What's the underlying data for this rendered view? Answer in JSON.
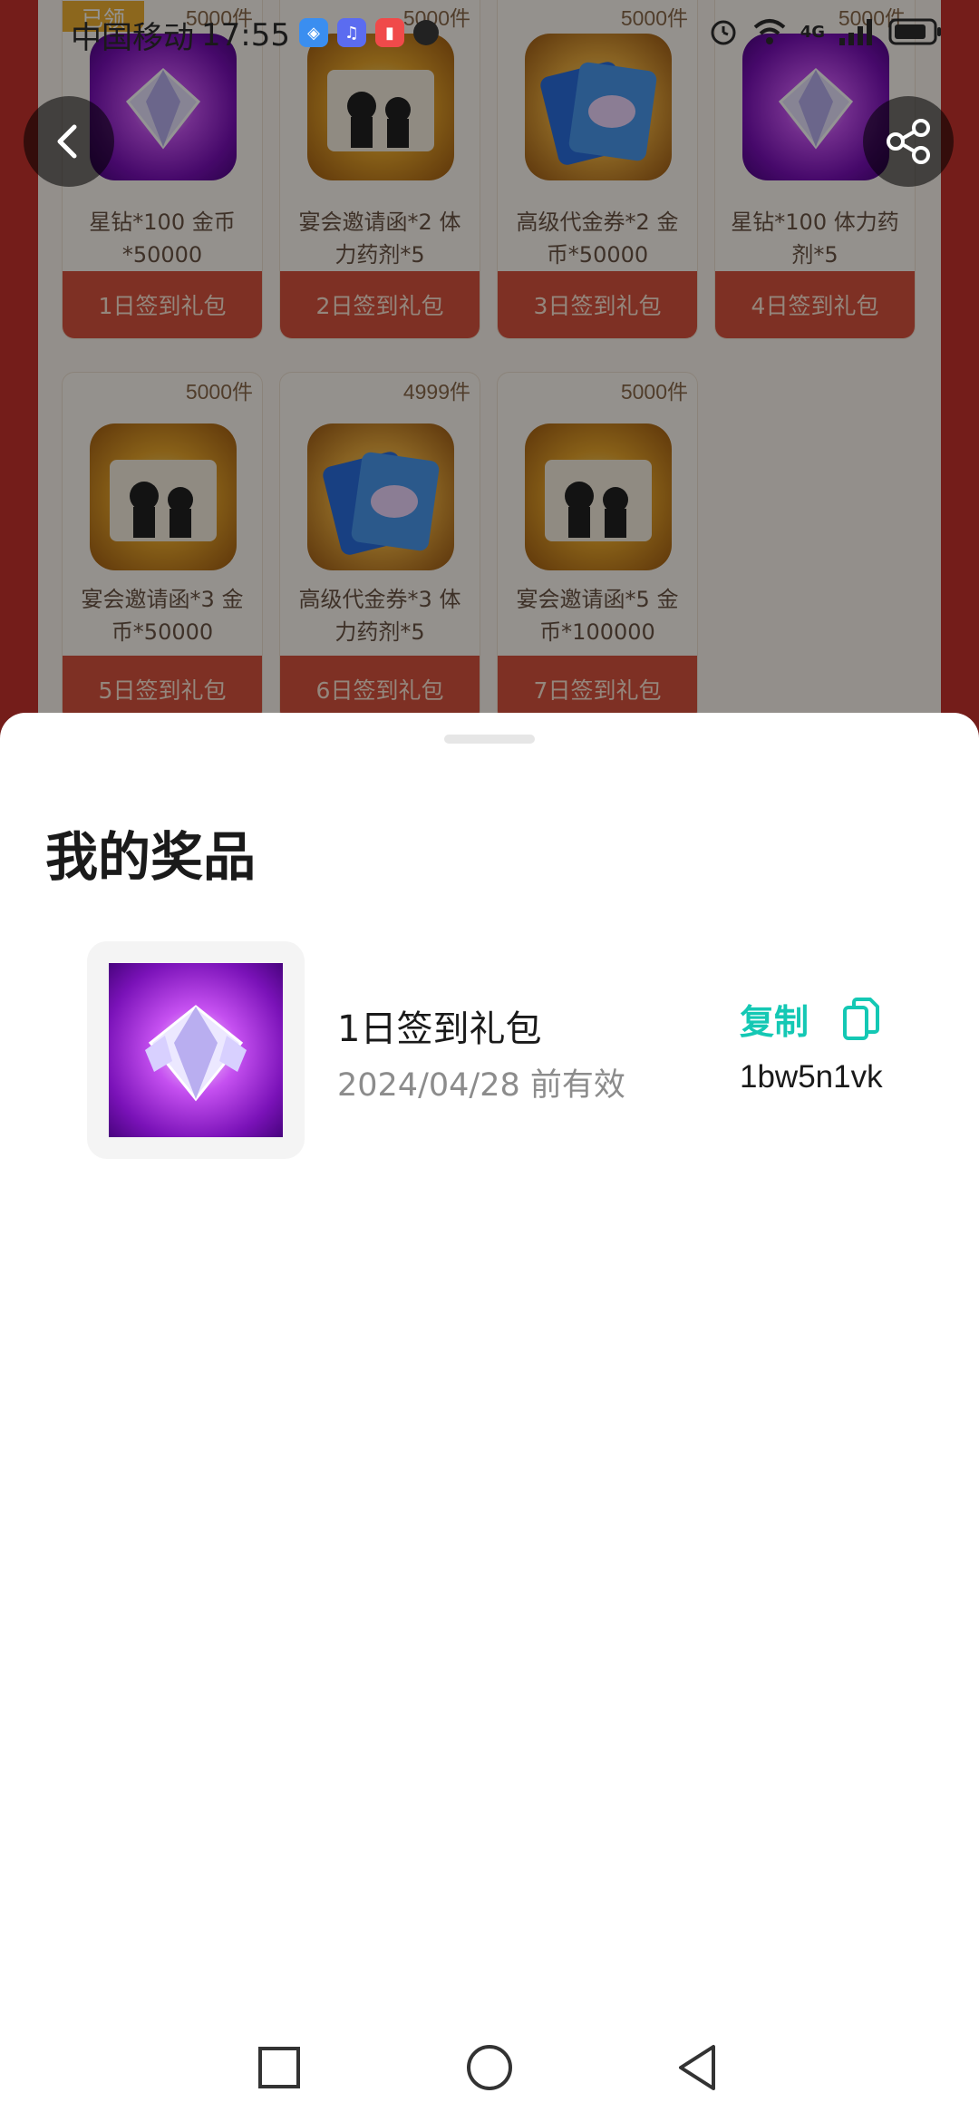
{
  "status_bar": {
    "carrier": "中国移动",
    "time": "17:55",
    "network": "4G"
  },
  "background_page": {
    "claimed_badge": "已领",
    "cards": [
      {
        "stock": "5000件",
        "desc": "星钻*100 金币*50000",
        "claim": "1日签到礼包",
        "icon": "diamond-icon"
      },
      {
        "stock": "5000件",
        "desc": "宴会邀请函*2 体力药剂*5",
        "claim": "2日签到礼包",
        "icon": "invitation-card-icon"
      },
      {
        "stock": "5000件",
        "desc": "高级代金券*2 金币*50000",
        "claim": "3日签到礼包",
        "icon": "voucher-card-icon"
      },
      {
        "stock": "5000件",
        "desc": "星钻*100 体力药剂*5",
        "claim": "4日签到礼包",
        "icon": "diamond-icon"
      },
      {
        "stock": "5000件",
        "desc": "宴会邀请函*3 金币*50000",
        "claim": "5日签到礼包",
        "icon": "invitation-card-icon"
      },
      {
        "stock": "4999件",
        "desc": "高级代金券*3 体力药剂*5",
        "claim": "6日签到礼包",
        "icon": "voucher-card-icon"
      },
      {
        "stock": "5000件",
        "desc": "宴会邀请函*5 金币*100000",
        "claim": "7日签到礼包",
        "icon": "invitation-card-icon"
      }
    ]
  },
  "sheet": {
    "title": "我的奖品",
    "prize": {
      "name": "1日签到礼包",
      "expiry": "2024/04/28 前有效",
      "copy_label": "复制",
      "code": "1bw5n1vk",
      "icon": "diamond-icon"
    }
  },
  "colors": {
    "accent": "#14c8b4",
    "background_red": "#c8332d",
    "claim_button": "#d9533f"
  }
}
